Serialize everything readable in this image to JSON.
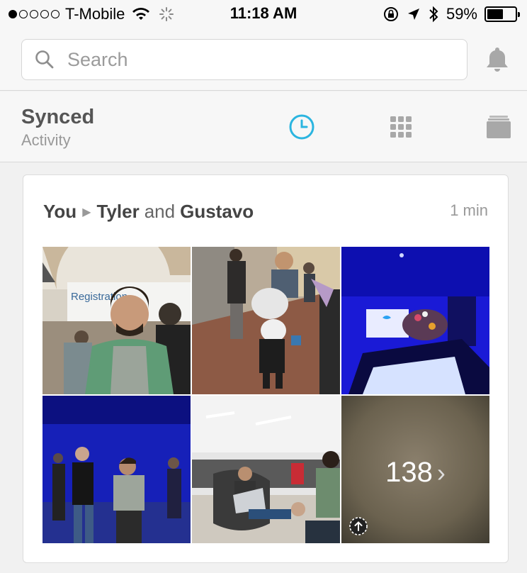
{
  "status_bar": {
    "carrier": "T-Mobile",
    "time": "11:18 AM",
    "battery_pct": "59%",
    "battery_level": 0.59,
    "signal_bars": 1
  },
  "search": {
    "placeholder": "Search",
    "value": ""
  },
  "tabs": {
    "title": "Synced",
    "subtitle": "Activity",
    "items": [
      {
        "icon": "clock-icon",
        "active": true
      },
      {
        "icon": "grid-icon",
        "active": false
      },
      {
        "icon": "stack-icon",
        "active": false
      }
    ],
    "accent": "#2bb5e0"
  },
  "card": {
    "sender": "You",
    "recipient_a": "Tyler",
    "connector": "and",
    "recipient_b": "Gustavo",
    "time": "1 min",
    "more_count": "138",
    "photos": [
      "Registration selfie",
      "Robot costume street",
      "Blue stage event",
      "Blue crowd photo",
      "Lounge laptop",
      "More photos"
    ]
  }
}
